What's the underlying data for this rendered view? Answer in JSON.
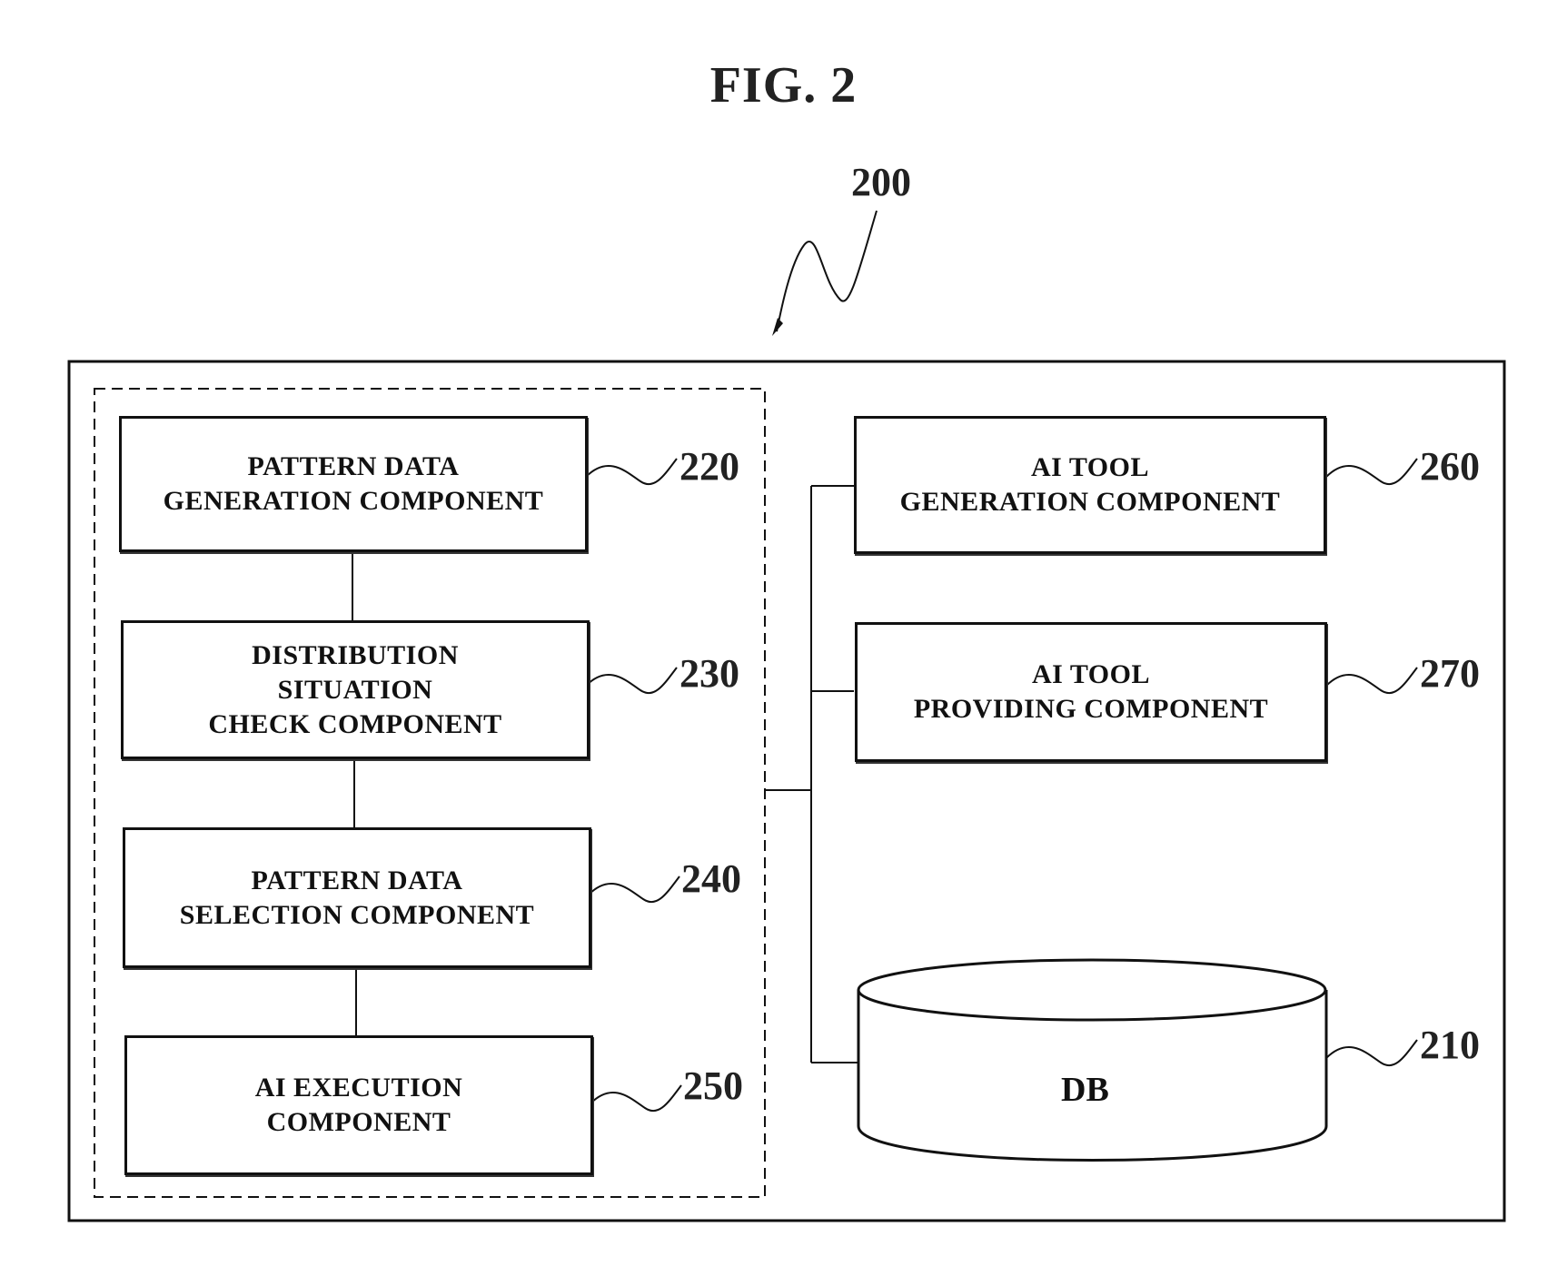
{
  "figure": {
    "title": "FIG. 2",
    "system_ref": "200"
  },
  "components": {
    "pattern_data_generation": {
      "lines": [
        "PATTERN DATA",
        "GENERATION COMPONENT"
      ],
      "ref": "220"
    },
    "distribution_situation_check": {
      "lines": [
        "DISTRIBUTION",
        "SITUATION",
        "CHECK COMPONENT"
      ],
      "ref": "230"
    },
    "pattern_data_selection": {
      "lines": [
        "PATTERN DATA",
        "SELECTION COMPONENT"
      ],
      "ref": "240"
    },
    "ai_execution": {
      "lines": [
        "AI EXECUTION",
        "COMPONENT"
      ],
      "ref": "250"
    },
    "ai_tool_generation": {
      "lines": [
        "AI TOOL",
        "GENERATION COMPONENT"
      ],
      "ref": "260"
    },
    "ai_tool_providing": {
      "lines": [
        "AI TOOL",
        "PROVIDING COMPONENT"
      ],
      "ref": "270"
    },
    "db": {
      "label": "DB",
      "ref": "210"
    }
  }
}
